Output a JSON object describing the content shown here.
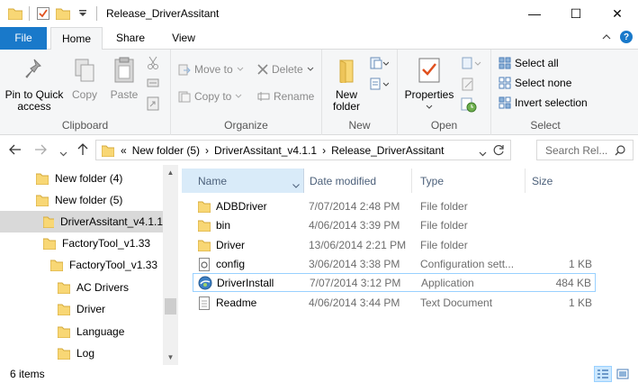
{
  "window": {
    "title": "Release_DriverAssitant",
    "controls": [
      "—",
      "☐",
      "✕"
    ]
  },
  "tabs": {
    "file": "File",
    "home": "Home",
    "share": "Share",
    "view": "View"
  },
  "ribbon": {
    "clipboard": {
      "label": "Clipboard",
      "pin": "Pin to Quick access",
      "copy": "Copy",
      "paste": "Paste"
    },
    "organize": {
      "label": "Organize",
      "move_to": "Move to",
      "copy_to": "Copy to",
      "delete": "Delete",
      "rename": "Rename"
    },
    "new": {
      "label": "New",
      "new_folder": "New folder"
    },
    "open": {
      "label": "Open",
      "properties": "Properties"
    },
    "select": {
      "label": "Select",
      "select_all": "Select all",
      "select_none": "Select none",
      "invert": "Invert selection"
    }
  },
  "address": {
    "overflow": "«",
    "crumbs": [
      "New folder (5)",
      "DriverAssitant_v4.1.1",
      "Release_DriverAssitant"
    ],
    "search_placeholder": "Search Rel..."
  },
  "tree": [
    {
      "label": "New folder (4)"
    },
    {
      "label": "New folder (5)"
    },
    {
      "label": "DriverAssitant_v4.1.1"
    },
    {
      "label": "FactoryTool_v1.33"
    },
    {
      "label": "FactoryTool_v1.33"
    },
    {
      "label": "AC Drivers"
    },
    {
      "label": "Driver"
    },
    {
      "label": "Language"
    },
    {
      "label": "Log"
    }
  ],
  "columns": {
    "name": "Name",
    "date": "Date modified",
    "type": "Type",
    "size": "Size"
  },
  "files": [
    {
      "name": "ADBDriver",
      "date": "7/07/2014 2:48 PM",
      "type": "File folder",
      "size": "",
      "icon": "folder-icon"
    },
    {
      "name": "bin",
      "date": "4/06/2014 3:39 PM",
      "type": "File folder",
      "size": "",
      "icon": "folder-icon"
    },
    {
      "name": "Driver",
      "date": "13/06/2014 2:21 PM",
      "type": "File folder",
      "size": "",
      "icon": "folder-icon"
    },
    {
      "name": "config",
      "date": "3/06/2014 3:38 PM",
      "type": "Configuration sett...",
      "size": "1 KB",
      "icon": "config-file-icon"
    },
    {
      "name": "DriverInstall",
      "date": "7/07/2014 3:12 PM",
      "type": "Application",
      "size": "484 KB",
      "icon": "application-icon"
    },
    {
      "name": "Readme",
      "date": "4/06/2014 3:44 PM",
      "type": "Text Document",
      "size": "1 KB",
      "icon": "text-file-icon"
    }
  ],
  "status": {
    "count": "6 items"
  },
  "colors": {
    "accent": "#1979ca",
    "folder": "#f8d775",
    "selection": "#d9d9d9",
    "highlight_border": "#99d1ff"
  }
}
